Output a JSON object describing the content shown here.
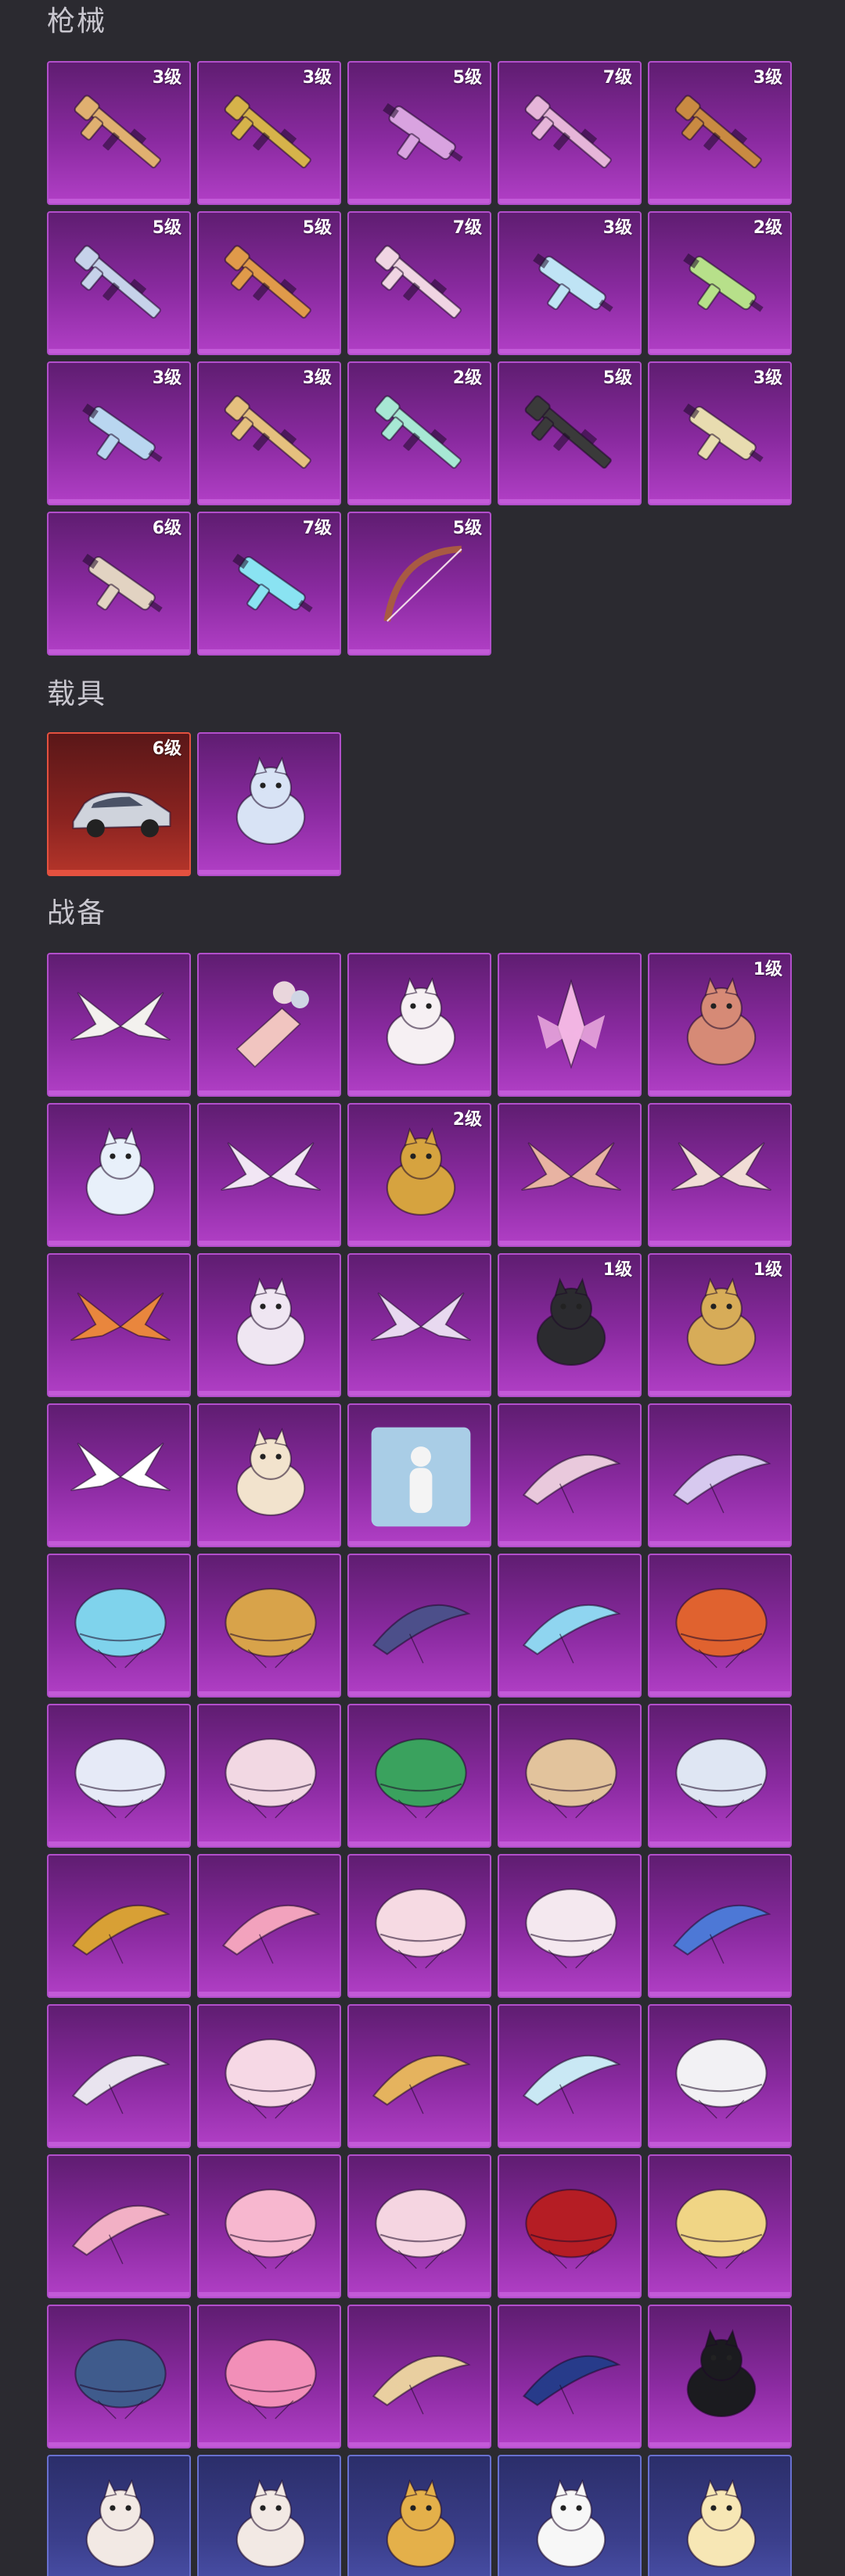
{
  "sections": {
    "guns": {
      "title": "枪械",
      "items": [
        {
          "label": "3级",
          "icon": "rifle-icon",
          "color": "#e0b070"
        },
        {
          "label": "3级",
          "icon": "rifle-icon",
          "color": "#d6b34a"
        },
        {
          "label": "5级",
          "icon": "smg-icon",
          "color": "#d9a3e0"
        },
        {
          "label": "7级",
          "icon": "rifle-icon",
          "color": "#e6b5d9"
        },
        {
          "label": "3级",
          "icon": "sniper-rifle-icon",
          "color": "#c98a42"
        },
        {
          "label": "5级",
          "icon": "shotgun-icon",
          "color": "#c6d2ea"
        },
        {
          "label": "5级",
          "icon": "rifle-icon",
          "color": "#e09a4a"
        },
        {
          "label": "7级",
          "icon": "rifle-icon",
          "color": "#f0d5e3"
        },
        {
          "label": "3级",
          "icon": "smg-icon",
          "color": "#bfe4f5"
        },
        {
          "label": "2级",
          "icon": "smg-icon",
          "color": "#b7e08a"
        },
        {
          "label": "3级",
          "icon": "smg-icon",
          "color": "#b9d6f0"
        },
        {
          "label": "3级",
          "icon": "machine-gun-icon",
          "color": "#e5c07e"
        },
        {
          "label": "2级",
          "icon": "rifle-icon",
          "color": "#a7e8d4"
        },
        {
          "label": "5级",
          "icon": "sniper-rifle-icon",
          "color": "#3a3a3a"
        },
        {
          "label": "3级",
          "icon": "bottle-gun-icon",
          "color": "#e8dcb0"
        },
        {
          "label": "6级",
          "icon": "ice-cream-gun-icon",
          "color": "#e2d3c2"
        },
        {
          "label": "7级",
          "icon": "creature-gun-icon",
          "color": "#8ae3f2"
        },
        {
          "label": "5级",
          "icon": "bow-icon",
          "color": "#a85a43"
        }
      ]
    },
    "vehicles": {
      "title": "载具",
      "items": [
        {
          "label": "6级",
          "icon": "car-icon",
          "color": "#cfd3dc",
          "tile": "red"
        },
        {
          "label": "",
          "icon": "crystal-horse-icon",
          "color": "#d8e3f5",
          "tile": "purple"
        }
      ]
    },
    "gear": {
      "title": "战备",
      "items": [
        {
          "label": "",
          "icon": "wing-icon",
          "color": "#f3f1ee"
        },
        {
          "label": "",
          "icon": "balloon-bag-icon",
          "color": "#f1c5c0"
        },
        {
          "label": "",
          "icon": "rabbit-icon",
          "color": "#f6f0f3"
        },
        {
          "label": "",
          "icon": "crystal-flower-icon",
          "color": "#f2b5e3"
        },
        {
          "label": "1级",
          "icon": "potato-pet-icon",
          "color": "#d68a76"
        },
        {
          "label": "",
          "icon": "cat-pet-icon",
          "color": "#e8f0fa"
        },
        {
          "label": "",
          "icon": "star-wings-icon",
          "color": "#f1e6f4"
        },
        {
          "label": "2级",
          "icon": "dragon-pet-icon",
          "color": "#d6a33f"
        },
        {
          "label": "",
          "icon": "blade-wings-icon",
          "color": "#e8b3a2"
        },
        {
          "label": "",
          "icon": "flame-wings-icon",
          "color": "#f1ddd6"
        },
        {
          "label": "",
          "icon": "fire-meteor-icon",
          "color": "#e9863d"
        },
        {
          "label": "",
          "icon": "hamster-pet-icon",
          "color": "#efe6f2"
        },
        {
          "label": "",
          "icon": "crystal-wings-icon",
          "color": "#e8d9f0"
        },
        {
          "label": "1级",
          "icon": "shadow-dragon-icon",
          "color": "#2b2b2f"
        },
        {
          "label": "1级",
          "icon": "pegasus-icon",
          "color": "#d7ac58"
        },
        {
          "label": "",
          "icon": "angel-wings-icon",
          "color": "#ffffff"
        },
        {
          "label": "",
          "icon": "baby-dragon-icon",
          "color": "#f2e3cd"
        },
        {
          "label": "",
          "icon": "emote-card-icon",
          "color": "#a9cde6"
        },
        {
          "label": "",
          "icon": "glider-icon",
          "color": "#e9c9dc"
        },
        {
          "label": "",
          "icon": "glider-icon",
          "color": "#d7c9ef"
        },
        {
          "label": "",
          "icon": "parachute-icon",
          "color": "#7fd3ec"
        },
        {
          "label": "",
          "icon": "parachute-icon",
          "color": "#d8a34a"
        },
        {
          "label": "",
          "icon": "glider-icon",
          "color": "#4c4f8a"
        },
        {
          "label": "",
          "icon": "glider-icon",
          "color": "#8fd5f0"
        },
        {
          "label": "",
          "icon": "parachute-icon",
          "color": "#e0622f"
        },
        {
          "label": "",
          "icon": "parachute-icon",
          "color": "#e6eaf7"
        },
        {
          "label": "",
          "icon": "parachute-icon",
          "color": "#f2d8e3"
        },
        {
          "label": "",
          "icon": "parachute-icon",
          "color": "#3aa25e"
        },
        {
          "label": "",
          "icon": "parachute-icon",
          "color": "#e2c39c"
        },
        {
          "label": "",
          "icon": "parachute-icon",
          "color": "#dfe6f3"
        },
        {
          "label": "",
          "icon": "glider-icon",
          "color": "#d8a035"
        },
        {
          "label": "",
          "icon": "glider-icon",
          "color": "#f2a2bd"
        },
        {
          "label": "",
          "icon": "parachute-icon",
          "color": "#f6dae3"
        },
        {
          "label": "",
          "icon": "parachute-icon",
          "color": "#f4e8ef"
        },
        {
          "label": "",
          "icon": "glider-icon",
          "color": "#4d78d6"
        },
        {
          "label": "",
          "icon": "glider-icon",
          "color": "#e9e4ef"
        },
        {
          "label": "",
          "icon": "parachute-icon",
          "color": "#f6d8e5"
        },
        {
          "label": "",
          "icon": "glider-icon",
          "color": "#e5b35e"
        },
        {
          "label": "",
          "icon": "glider-icon",
          "color": "#c9e8f4"
        },
        {
          "label": "",
          "icon": "parachute-icon",
          "color": "#f2f1f4"
        },
        {
          "label": "",
          "icon": "glider-icon",
          "color": "#f2b0c5"
        },
        {
          "label": "",
          "icon": "parachute-icon",
          "color": "#f7b7cf"
        },
        {
          "label": "",
          "icon": "parachute-icon",
          "color": "#f5d5e1"
        },
        {
          "label": "",
          "icon": "parachute-icon",
          "color": "#b51d24"
        },
        {
          "label": "",
          "icon": "parachute-icon",
          "color": "#f0d585"
        },
        {
          "label": "",
          "icon": "parachute-icon",
          "color": "#3f5b8c"
        },
        {
          "label": "",
          "icon": "parachute-icon",
          "color": "#f28fb8"
        },
        {
          "label": "",
          "icon": "glider-icon",
          "color": "#e9cfa0"
        },
        {
          "label": "",
          "icon": "glider-icon",
          "color": "#273b8a"
        },
        {
          "label": "",
          "icon": "cat-face-icon",
          "color": "#1b1b1f"
        },
        {
          "label": "",
          "icon": "fox-pet-icon",
          "color": "#f2e9e4",
          "tile": "blue"
        },
        {
          "label": "",
          "icon": "sheep-pet-icon",
          "color": "#f2e9e4",
          "tile": "blue"
        },
        {
          "label": "",
          "icon": "chicken-pet-icon",
          "color": "#e4b04a",
          "tile": "blue"
        },
        {
          "label": "",
          "icon": "bear-pet-icon",
          "color": "#f7f7f7",
          "tile": "blue"
        },
        {
          "label": "",
          "icon": "chick-pet-icon",
          "color": "#f7e7b5",
          "tile": "blue"
        }
      ]
    }
  }
}
